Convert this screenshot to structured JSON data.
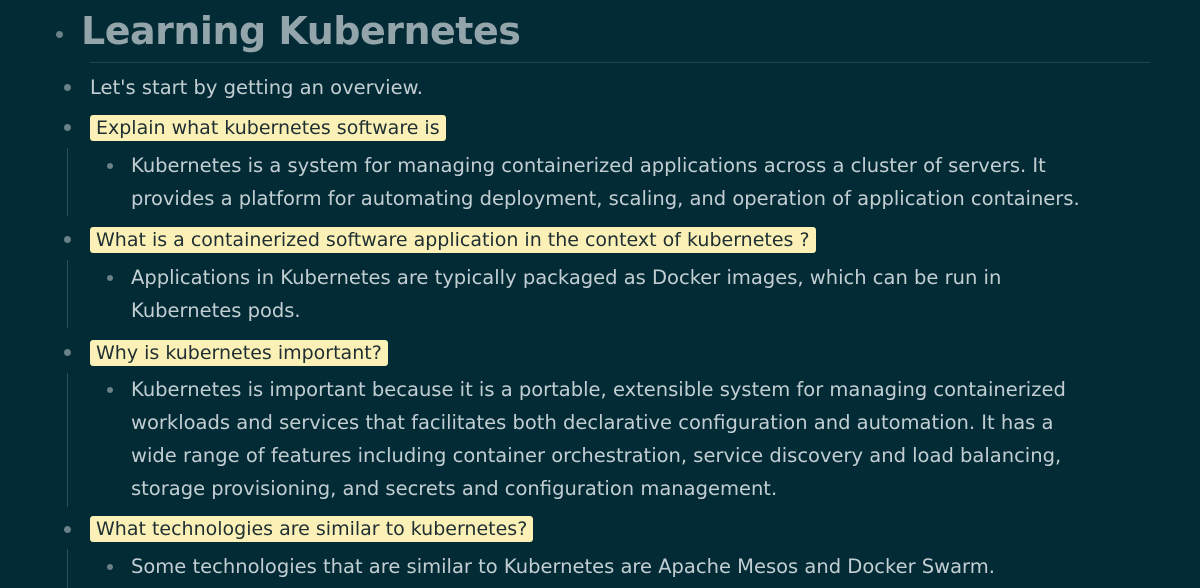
{
  "page": {
    "title": "Learning Kubernetes"
  },
  "outline": {
    "intro": "Let's start by getting an overview.",
    "items": [
      {
        "question": "Explain what kubernetes software is",
        "answer_lines": [
          "Kubernetes is a system for managing containerized applications across a cluster of servers. It",
          "provides a platform for automating deployment, scaling, and operation of application containers."
        ]
      },
      {
        "question": "What is a containerized software application in the context of kubernetes ?",
        "answer_lines": [
          "Applications in Kubernetes are typically packaged as Docker images, which can be run in",
          "Kubernetes pods."
        ]
      },
      {
        "question": "Why is kubernetes important?",
        "answer_lines": [
          "Kubernetes is important because it is a portable, extensible system for managing containerized",
          "workloads and services that facilitates both declarative configuration and automation. It has a",
          "wide range of features including container orchestration, service discovery and load balancing,",
          "storage provisioning, and secrets and configuration management."
        ]
      },
      {
        "question": "What technologies are similar to kubernetes?",
        "answer_lines": [
          "Some technologies that are similar to Kubernetes are Apache Mesos and Docker Swarm."
        ]
      }
    ]
  },
  "colors": {
    "background": "#032b36",
    "highlight": "#fbf1b6",
    "text": "#c2ced2",
    "title": "#93a5aa"
  }
}
